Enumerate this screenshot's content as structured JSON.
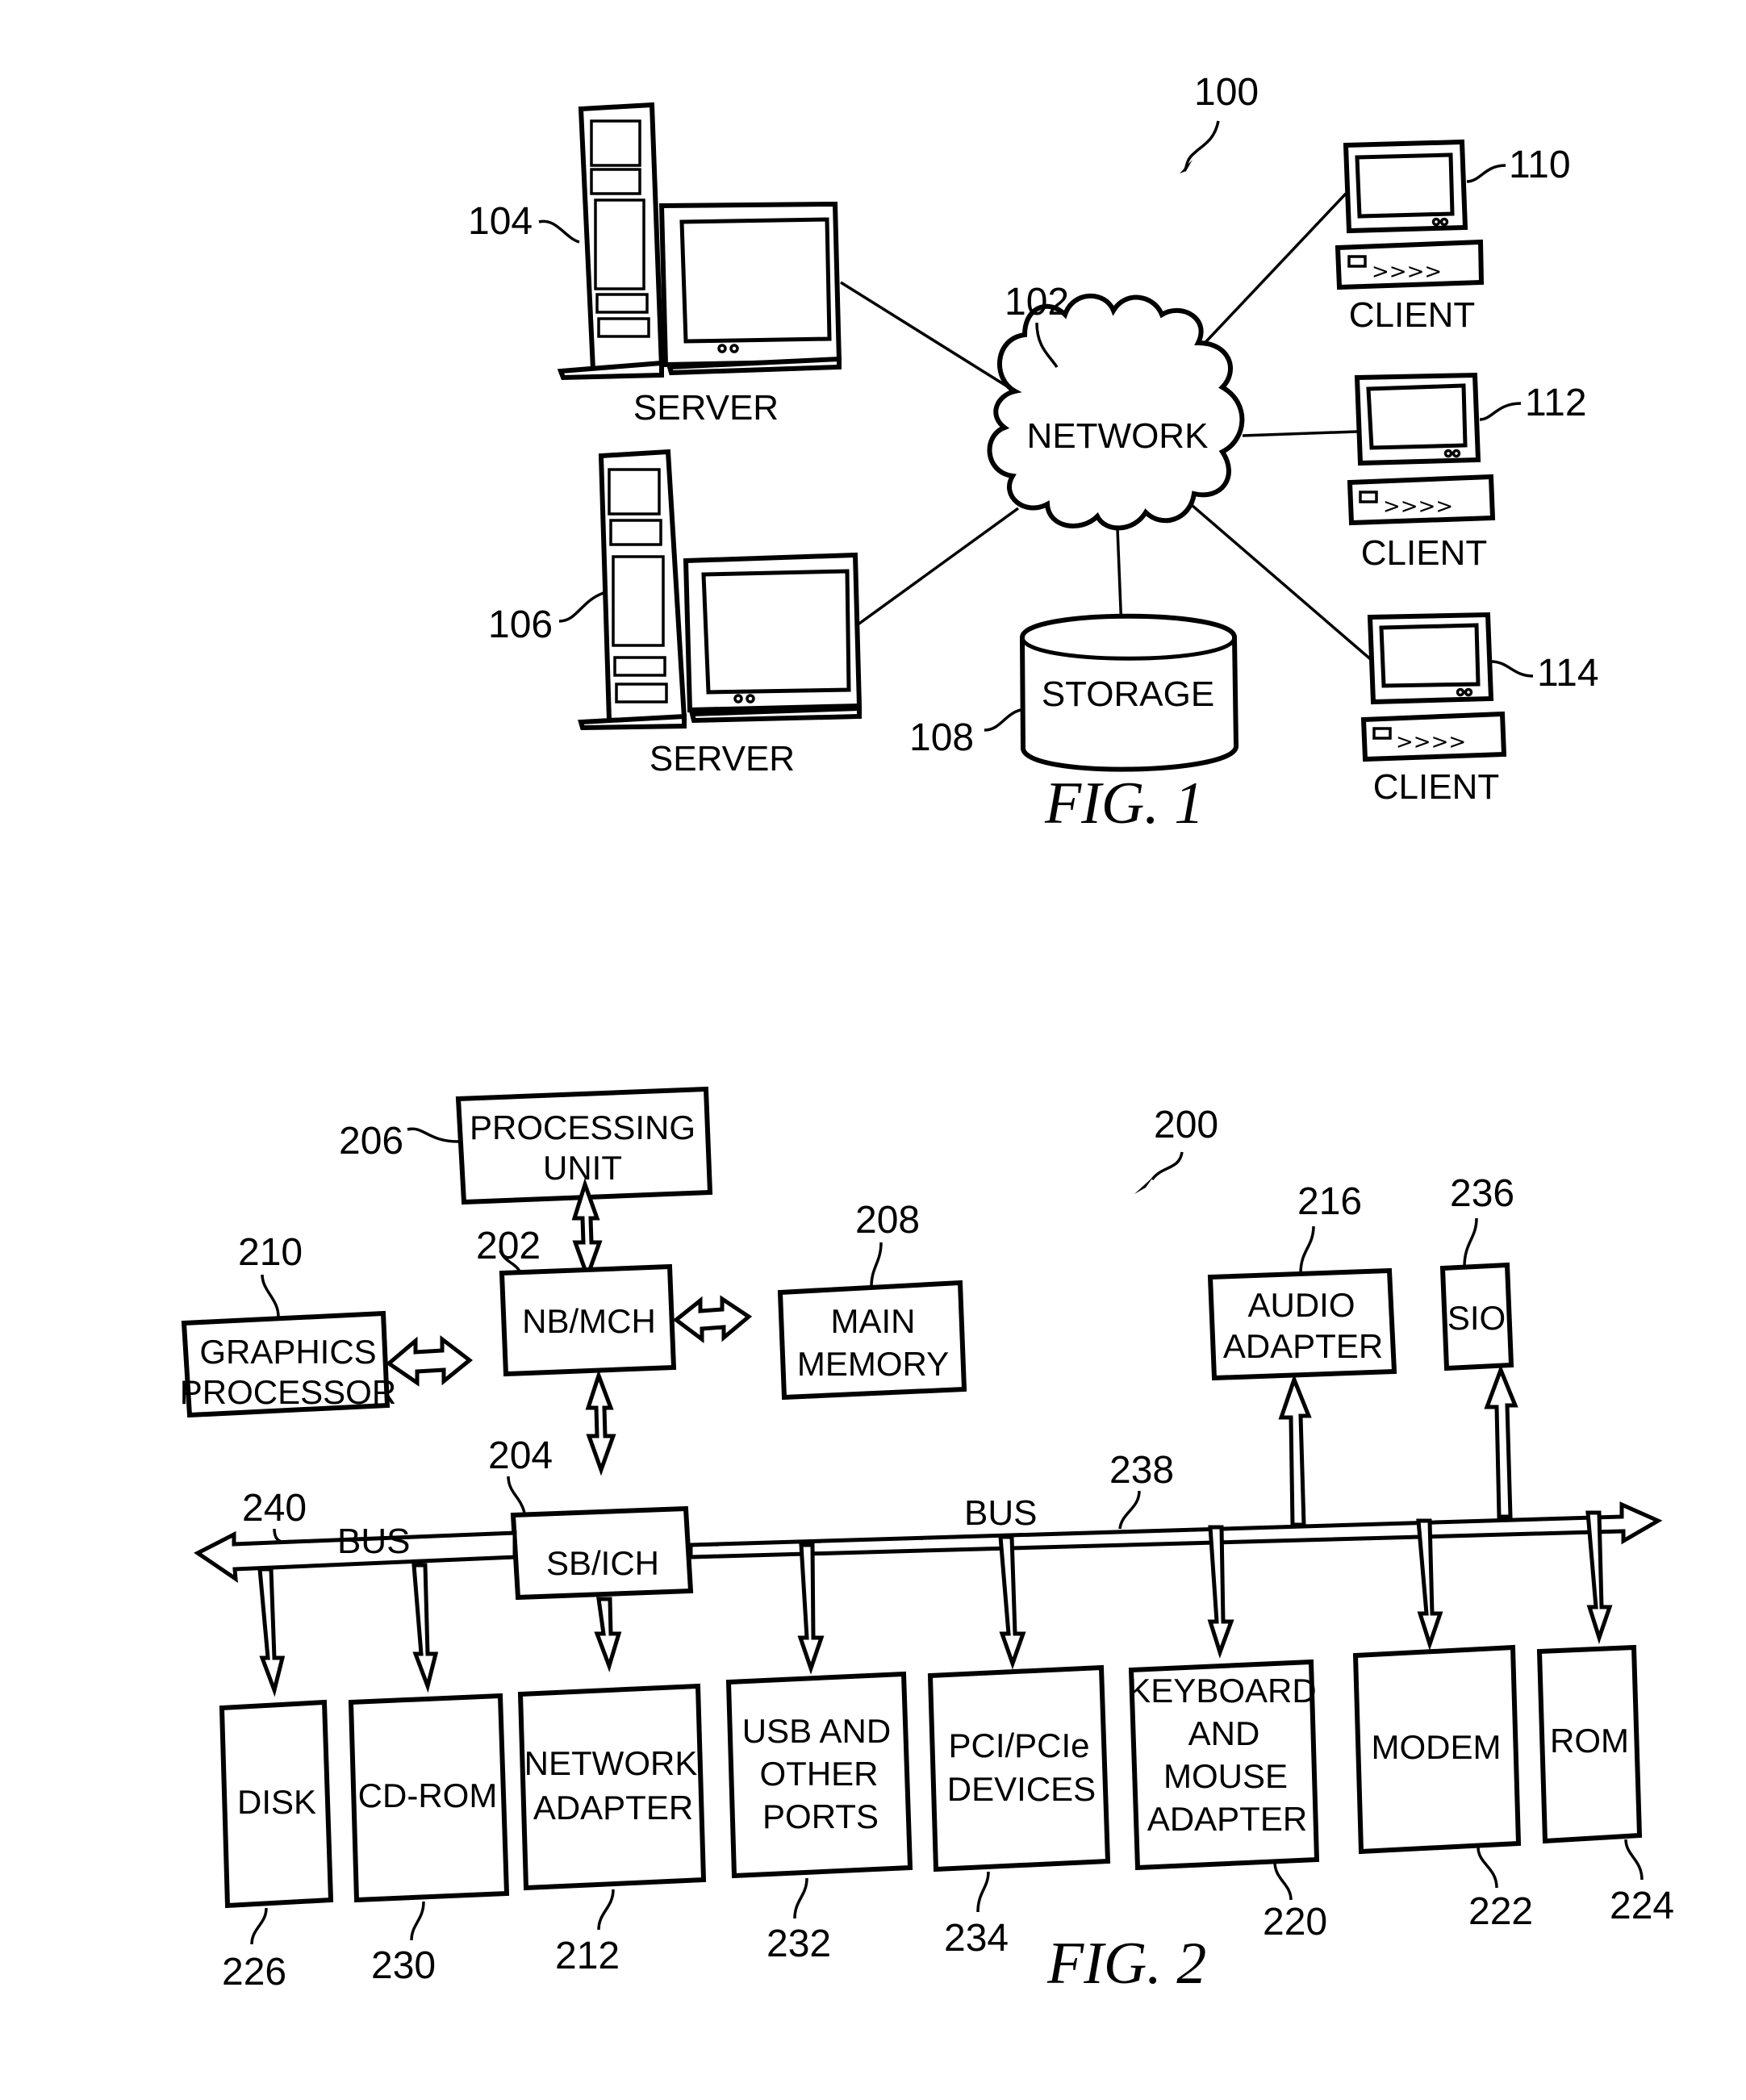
{
  "fig1": {
    "caption": "FIG. 1",
    "system_ref": "100",
    "network": {
      "label": "NETWORK",
      "ref": "102"
    },
    "servers": [
      {
        "label": "SERVER",
        "ref": "104"
      },
      {
        "label": "SERVER",
        "ref": "106"
      }
    ],
    "storage": {
      "label": "STORAGE",
      "ref": "108"
    },
    "clients": [
      {
        "label": "CLIENT",
        "ref": "110"
      },
      {
        "label": "CLIENT",
        "ref": "112"
      },
      {
        "label": "CLIENT",
        "ref": "114"
      }
    ]
  },
  "fig2": {
    "caption": "FIG. 2",
    "system_ref": "200",
    "processing_unit": {
      "line1": "PROCESSING",
      "line2": "UNIT",
      "ref": "206"
    },
    "nb_mch": {
      "label": "NB/MCH",
      "ref": "202"
    },
    "main_memory": {
      "line1": "MAIN",
      "line2": "MEMORY",
      "ref": "208"
    },
    "graphics_processor": {
      "line1": "GRAPHICS",
      "line2": "PROCESSOR",
      "ref": "210"
    },
    "sb_ich": {
      "label": "SB/ICH",
      "ref": "204"
    },
    "audio_adapter": {
      "line1": "AUDIO",
      "line2": "ADAPTER",
      "ref": "216"
    },
    "sio": {
      "label": "SIO",
      "ref": "236"
    },
    "bus_left": {
      "label": "BUS",
      "ref": "240"
    },
    "bus_right": {
      "label": "BUS",
      "ref": "238"
    },
    "disk": {
      "label": "DISK",
      "ref": "226"
    },
    "cd_rom": {
      "label": "CD-ROM",
      "ref": "230"
    },
    "network_adapter": {
      "line1": "NETWORK",
      "line2": "ADAPTER",
      "ref": "212"
    },
    "usb_ports": {
      "line1": "USB AND",
      "line2": "OTHER",
      "line3": "PORTS",
      "ref": "232"
    },
    "pci_devices": {
      "line1": "PCI/PCIe",
      "line2": "DEVICES",
      "ref": "234"
    },
    "kbd_mouse": {
      "line1": "KEYBOARD",
      "line2": "AND",
      "line3": "MOUSE",
      "line4": "ADAPTER",
      "ref": "220"
    },
    "modem": {
      "label": "MODEM",
      "ref": "222"
    },
    "rom": {
      "label": "ROM",
      "ref": "224"
    }
  }
}
